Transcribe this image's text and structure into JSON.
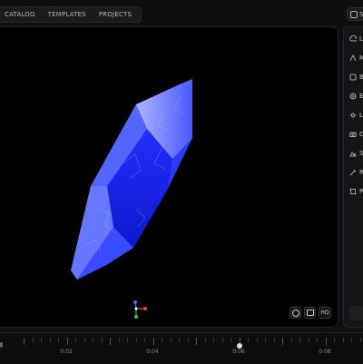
{
  "tabs": [
    {
      "label": "CATALOG"
    },
    {
      "label": "TEMPLATES"
    },
    {
      "label": "PROJECTS"
    }
  ],
  "top_right": {
    "label": "S"
  },
  "sidebar": {
    "items": [
      {
        "label": "Li",
        "icon": "upload-icon"
      },
      {
        "label": "M",
        "icon": "material-icon"
      },
      {
        "label": "B",
        "icon": "background-icon"
      },
      {
        "label": "E",
        "icon": "environment-icon"
      },
      {
        "label": "Li",
        "icon": "light-icon"
      },
      {
        "label": "C",
        "icon": "camera-icon"
      },
      {
        "label": "S",
        "icon": "scene-icon"
      },
      {
        "label": "R",
        "icon": "render-icon"
      },
      {
        "label": "P",
        "icon": "post-processing-icon"
      }
    ]
  },
  "viewport": {
    "buttons": [
      {
        "label": "",
        "icon": "layers-icon"
      },
      {
        "label": "",
        "icon": "frame-icon"
      },
      {
        "label": "HQ",
        "icon": ""
      }
    ]
  },
  "timeline": {
    "labels": [
      "0:02",
      "0:04",
      "0:06",
      "0:08"
    ]
  },
  "colors": {
    "background": "#0f0f10",
    "viewport": "#000000",
    "crystal": "#2a3cff"
  }
}
